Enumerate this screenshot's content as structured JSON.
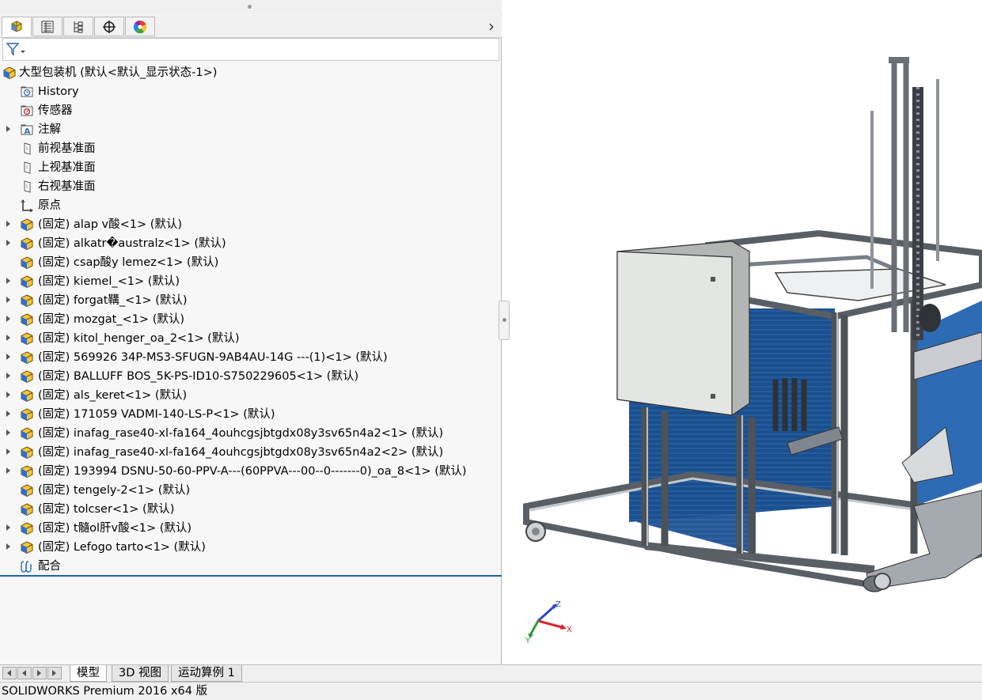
{
  "feature_manager": {
    "tabs": [
      {
        "name": "feature-manager-tab",
        "icon": "feature-tree-icon"
      },
      {
        "name": "property-manager-tab",
        "icon": "property-manager-icon"
      },
      {
        "name": "configuration-manager-tab",
        "icon": "configuration-manager-icon"
      },
      {
        "name": "dimxpert-manager-tab",
        "icon": "crosshair-icon"
      },
      {
        "name": "display-manager-tab",
        "icon": "color-wheel-icon"
      }
    ],
    "more_tabs": "›",
    "filter_icon": "filter-icon"
  },
  "tree": {
    "root": {
      "label": "大型包装机  (默认<默认_显示状态-1>)",
      "icon": "assembly-icon"
    },
    "items": [
      {
        "label": "History",
        "icon": "history-folder-icon",
        "expandable": false
      },
      {
        "label": "传感器",
        "icon": "sensors-folder-icon",
        "expandable": false
      },
      {
        "label": "注解",
        "icon": "annotations-folder-icon",
        "expandable": true
      },
      {
        "label": "前视基准面",
        "icon": "plane-icon",
        "expandable": false
      },
      {
        "label": "上视基准面",
        "icon": "plane-icon",
        "expandable": false
      },
      {
        "label": "右视基准面",
        "icon": "plane-icon",
        "expandable": false
      },
      {
        "label": "原点",
        "icon": "origin-icon",
        "expandable": false
      },
      {
        "label": "(固定) alap v酸<1> (默认)",
        "icon": "subassembly-icon",
        "expandable": true
      },
      {
        "label": "(固定) alkatr�australz<1> (默认)",
        "icon": "subassembly-icon",
        "expandable": true
      },
      {
        "label": "(固定) csap酸y lemez<1> (默认)",
        "icon": "subassembly-icon",
        "expandable": false
      },
      {
        "label": "(固定) kiemel_<1> (默认)",
        "icon": "subassembly-icon",
        "expandable": true
      },
      {
        "label": "(固定) forgat鞲_<1> (默认)",
        "icon": "subassembly-icon",
        "expandable": true
      },
      {
        "label": "(固定) mozgat_<1> (默认)",
        "icon": "subassembly-icon",
        "expandable": true
      },
      {
        "label": "(固定) kitol_henger_oa_2<1> (默认)",
        "icon": "subassembly-icon",
        "expandable": true
      },
      {
        "label": "(固定) 569926 34P-MS3-SFUGN-9AB4AU-14G ---(1)<1> (默认)",
        "icon": "subassembly-icon",
        "expandable": true
      },
      {
        "label": "(固定) BALLUFF BOS_5K-PS-ID10-S750229605<1> (默认)",
        "icon": "subassembly-icon",
        "expandable": true
      },
      {
        "label": "(固定) als_keret<1> (默认)",
        "icon": "subassembly-icon",
        "expandable": true
      },
      {
        "label": "(固定) 171059 VADMI-140-LS-P<1> (默认)",
        "icon": "subassembly-icon",
        "expandable": true
      },
      {
        "label": "(固定) inafag_rase40-xl-fa164_4ouhcgsjbtgdx08y3sv65n4a2<1> (默认)",
        "icon": "subassembly-icon",
        "expandable": true
      },
      {
        "label": "(固定) inafag_rase40-xl-fa164_4ouhcgsjbtgdx08y3sv65n4a2<2> (默认)",
        "icon": "subassembly-icon",
        "expandable": true
      },
      {
        "label": "(固定) 193994 DSNU-50-60-PPV-A---(60PPVA---00--0-------0)_oa_8<1> (默认)",
        "icon": "subassembly-icon",
        "expandable": true
      },
      {
        "label": "(固定) tengely-2<1> (默认)",
        "icon": "subassembly-icon",
        "expandable": false
      },
      {
        "label": "(固定) tolcser<1> (默认)",
        "icon": "subassembly-icon",
        "expandable": false
      },
      {
        "label": "(固定) t髓ol肝v酸<1> (默认)",
        "icon": "subassembly-icon",
        "expandable": true
      },
      {
        "label": "(固定) Lefogo tarto<1> (默认)",
        "icon": "subassembly-icon",
        "expandable": true
      },
      {
        "label": "配合",
        "icon": "mates-icon",
        "expandable": false
      }
    ]
  },
  "bottom_tabs": {
    "nav_buttons": [
      "first-icon",
      "prev-icon",
      "next-icon",
      "last-icon"
    ],
    "tabs": [
      {
        "label": "模型",
        "active": true
      },
      {
        "label": "3D 视图",
        "active": false
      },
      {
        "label": "运动算例 1",
        "active": false
      }
    ]
  },
  "status_bar": {
    "text": "SOLIDWORKS Premium 2016 x64 版"
  },
  "viewport": {
    "model": "packaging-machine-model",
    "triad": {
      "x": "X",
      "y": "Y",
      "z": "Z"
    },
    "colors": {
      "frame": "#9aa0a6",
      "panel_blue": "#1c4f8c",
      "cabinet": "#e2e4e2",
      "x_axis": "#d6262b",
      "y_axis": "#2f9a35",
      "z_axis": "#2a46c8"
    }
  }
}
